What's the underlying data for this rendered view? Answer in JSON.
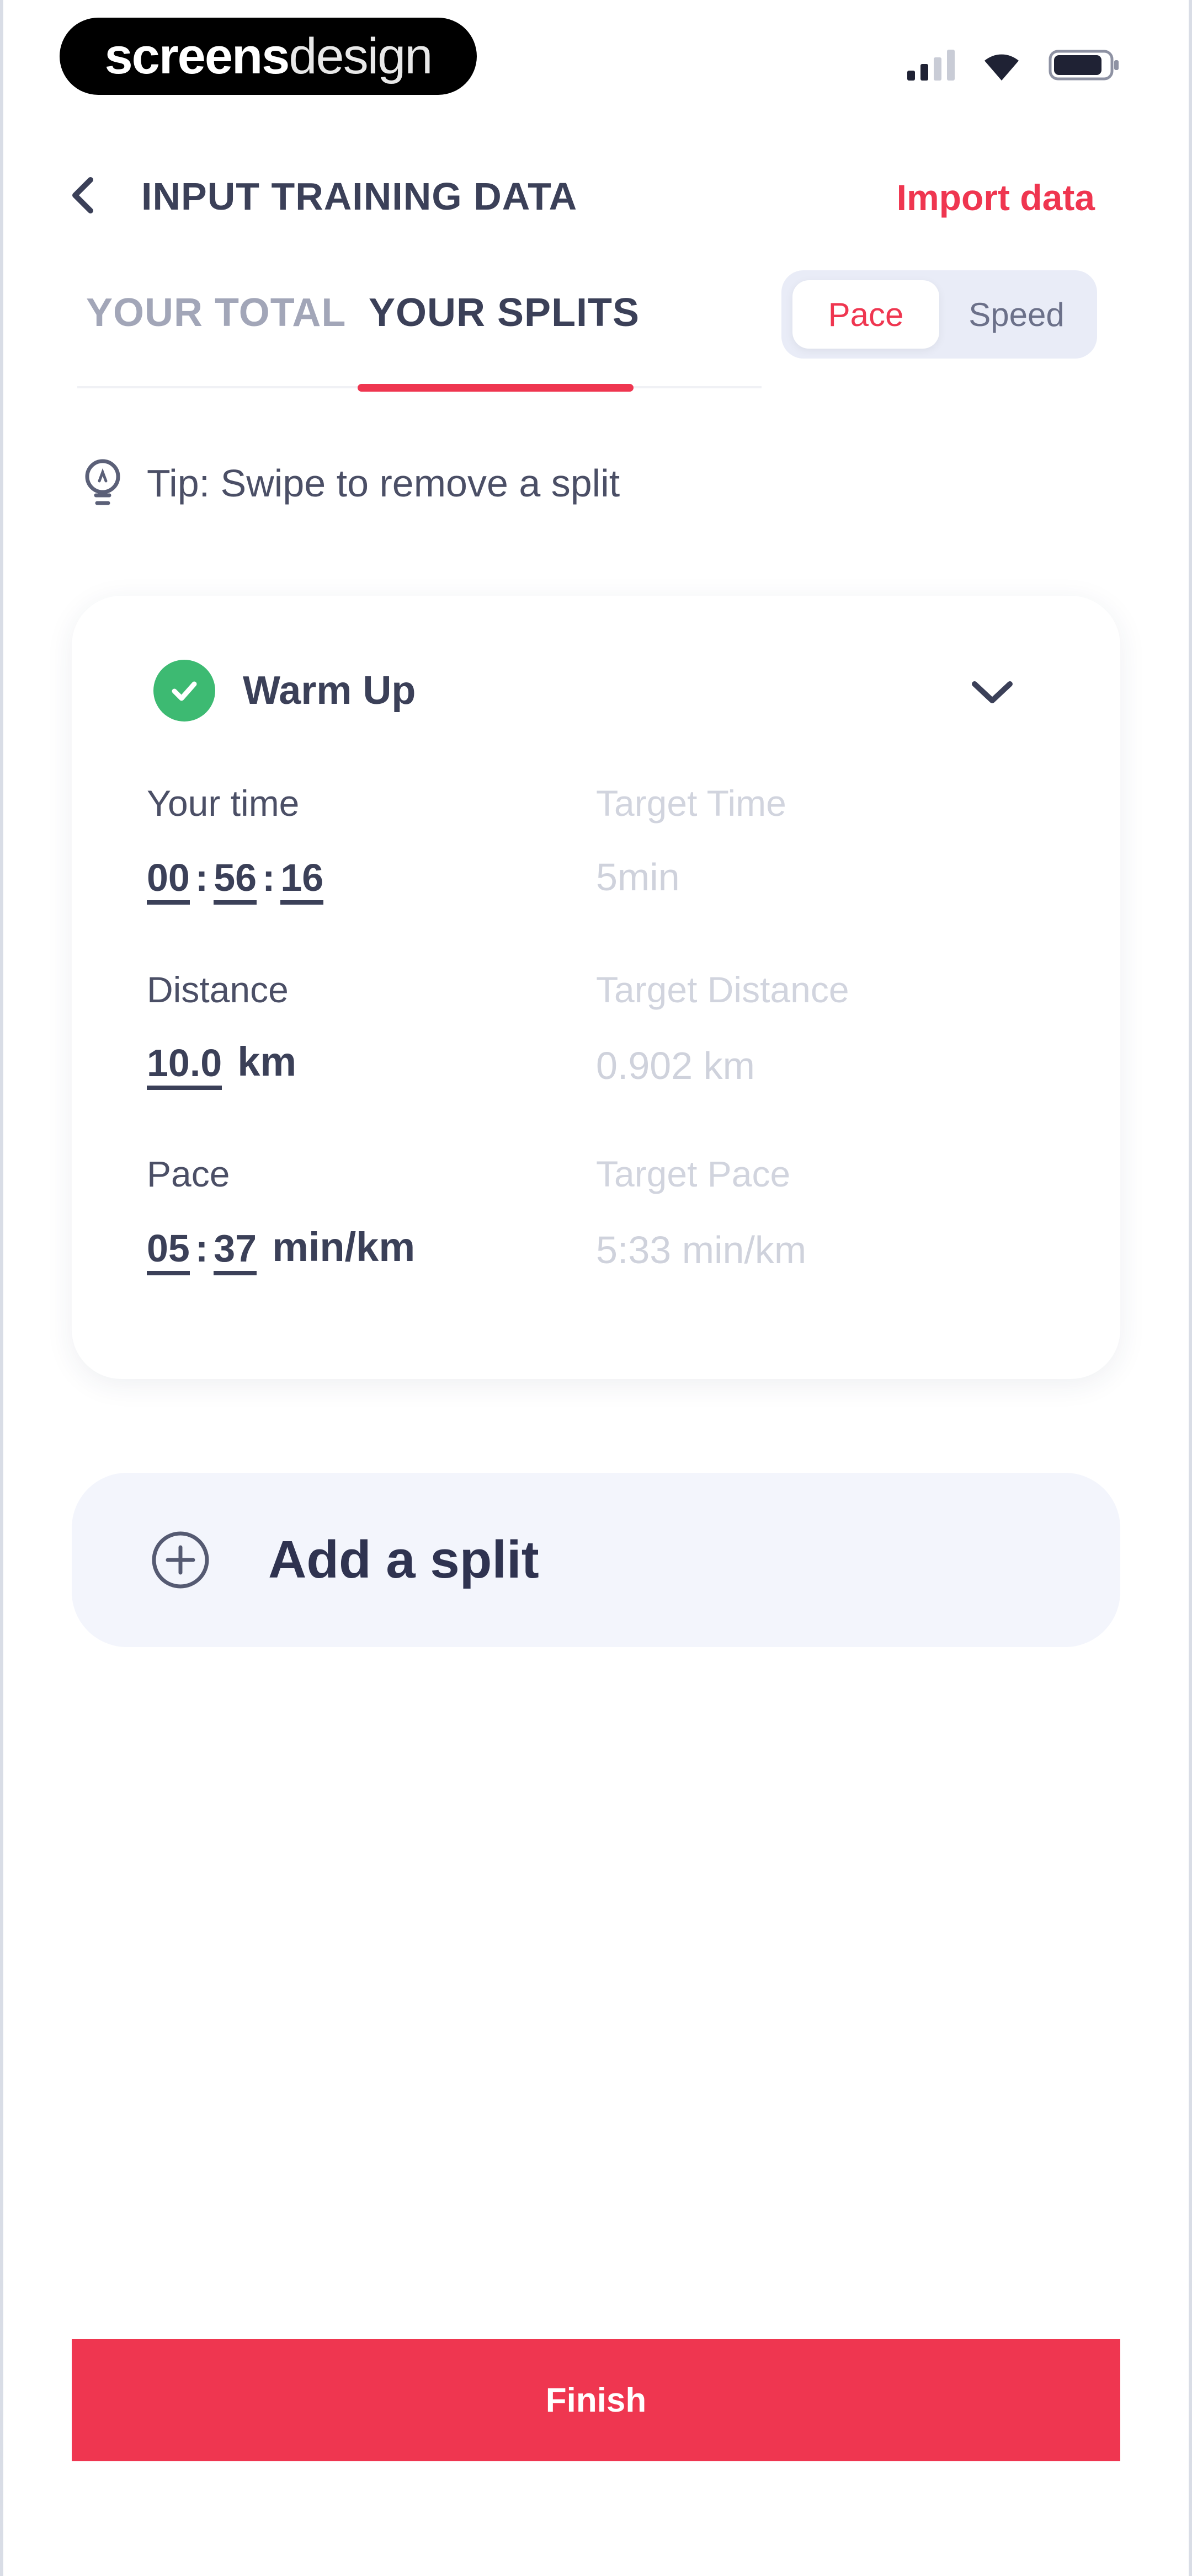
{
  "status_bar": {
    "brand_bold": "screens",
    "brand_light": "design"
  },
  "header": {
    "title": "INPUT TRAINING DATA",
    "import_label": "Import data"
  },
  "tabs": [
    {
      "label": "YOUR TOTAL"
    },
    {
      "label": "YOUR SPLITS",
      "active": true
    }
  ],
  "mode_toggle": {
    "options": [
      "Pace",
      "Speed"
    ],
    "selected": "Pace"
  },
  "tip": {
    "text": "Tip: Swipe to remove a split"
  },
  "split": {
    "name": "Warm Up",
    "completed": true,
    "your_time": {
      "label": "Your time",
      "hh": "00",
      "mm": "56",
      "ss": "16"
    },
    "target_time": {
      "label": "Target Time",
      "value": "5min"
    },
    "distance": {
      "label": "Distance",
      "value": "10.0",
      "unit": "km"
    },
    "target_distance": {
      "label": "Target Distance",
      "value": "0.902 km"
    },
    "pace": {
      "label": "Pace",
      "min": "05",
      "sec": "37",
      "unit": "min/km"
    },
    "target_pace": {
      "label": "Target Pace",
      "value": "5:33 min/km"
    }
  },
  "add_split": {
    "label": "Add a split"
  },
  "finish": {
    "label": "Finish"
  },
  "colors": {
    "accent": "#ef3650",
    "success": "#3dba72",
    "text": "#3b4058",
    "muted": "#a2a6b8"
  }
}
